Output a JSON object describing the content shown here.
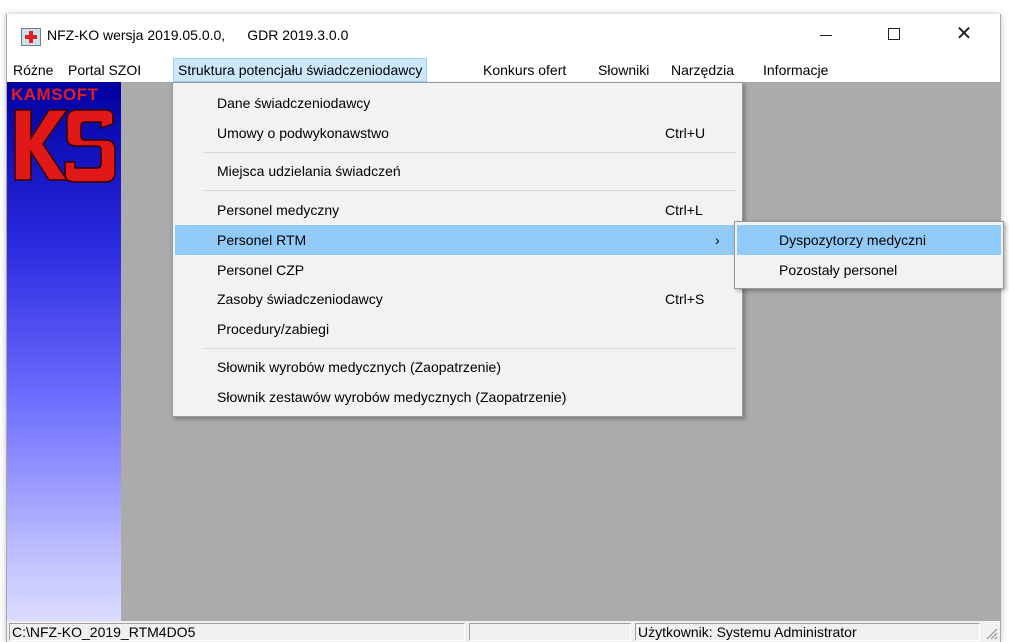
{
  "titlebar": {
    "app_title": "NFZ-KO wersja 2019.05.0.0,",
    "gdr_version": "GDR 2019.3.0.0",
    "close_glyph": "✕"
  },
  "menubar": {
    "items": [
      {
        "label": "Różne"
      },
      {
        "label": "Portal SZOI"
      },
      {
        "label": "Struktura potencjału świadczeniodawcy"
      },
      {
        "label": "Konkurs ofert"
      },
      {
        "label": "Słowniki"
      },
      {
        "label": "Narzędzia"
      },
      {
        "label": "Informacje"
      }
    ]
  },
  "sidebar": {
    "logo_text": "KAMSOFT",
    "logo_letters": "KS",
    "gradient_top": "#0000a0",
    "gradient_bottom": "#dcdcff"
  },
  "dropdown": {
    "items": [
      {
        "label": "Dane świadczeniodawcy",
        "shortcut": ""
      },
      {
        "label": "Umowy o podwykonawstwo",
        "shortcut": "Ctrl+U"
      },
      {
        "label": "Miejsca udzielania świadczeń",
        "shortcut": ""
      },
      {
        "label": "Personel medyczny",
        "shortcut": "Ctrl+L"
      },
      {
        "label": "Personel RTM",
        "shortcut": "›"
      },
      {
        "label": "Personel CZP",
        "shortcut": ""
      },
      {
        "label": "Zasoby świadczeniodawcy",
        "shortcut": "Ctrl+S"
      },
      {
        "label": "Procedury/zabiegi",
        "shortcut": ""
      },
      {
        "label": "Słownik wyrobów medycznych (Zaopatrzenie)",
        "shortcut": ""
      },
      {
        "label": "Słownik zestawów wyrobów medycznych (Zaopatrzenie)",
        "shortcut": ""
      }
    ],
    "highlight_color": "#91c9f7"
  },
  "submenu": {
    "items": [
      {
        "label": "Dyspozytorzy medyczni"
      },
      {
        "label": "Pozostały personel"
      }
    ]
  },
  "statusbar": {
    "path": "C:\\NFZ-KO_2019_RTM4DO5",
    "user": "Użytkownik: Systemu Administrator"
  }
}
